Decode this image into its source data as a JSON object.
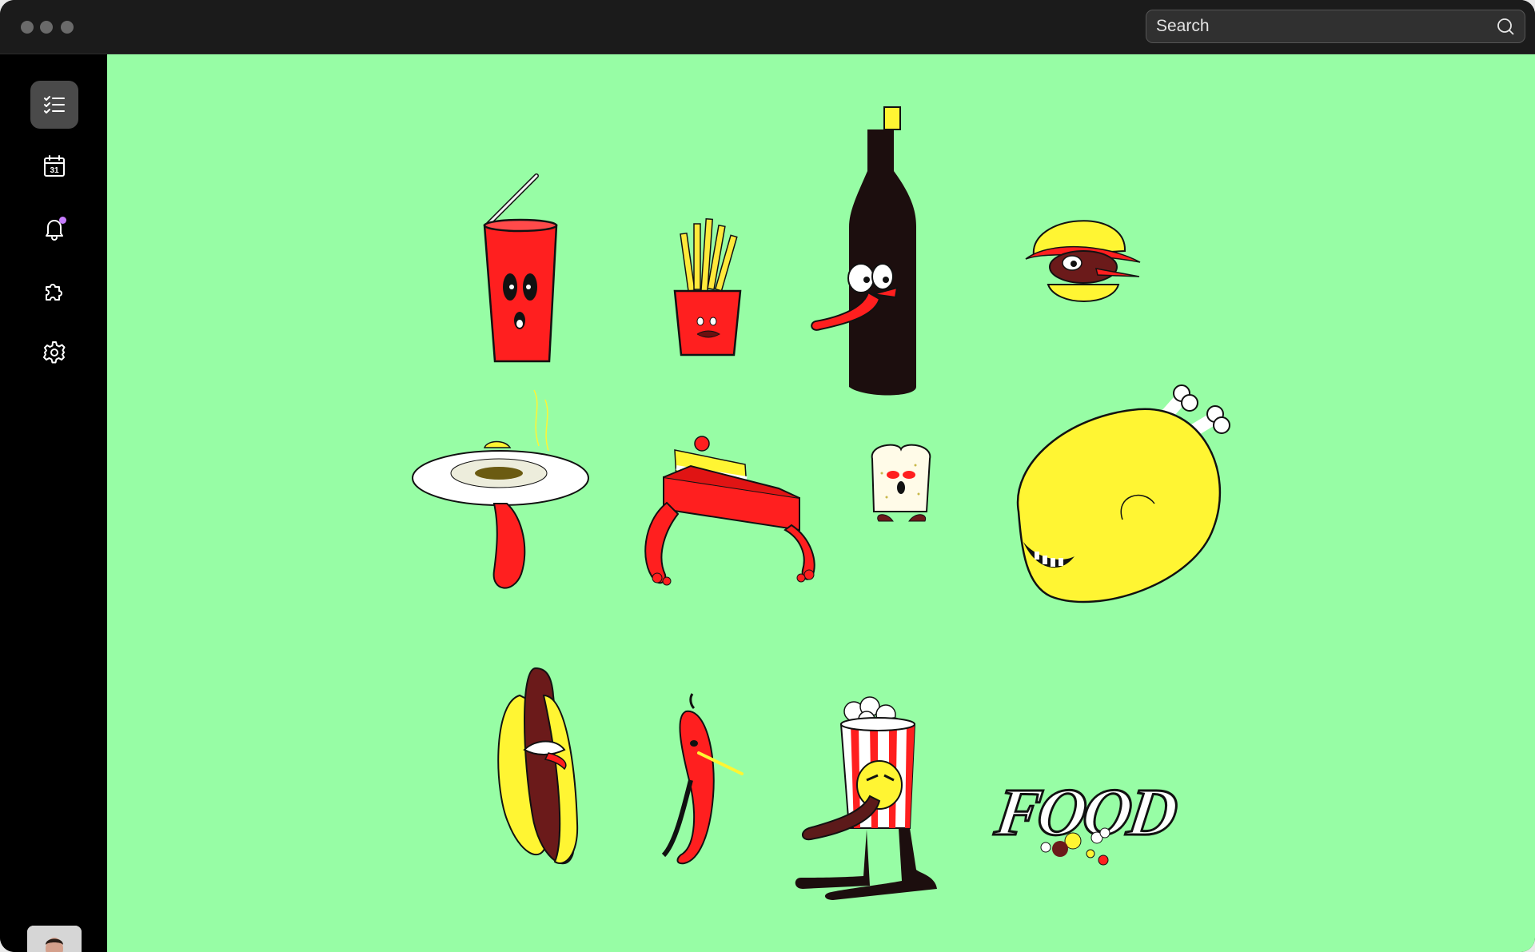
{
  "window": {
    "controls": [
      "window-dot",
      "window-dot",
      "window-dot"
    ]
  },
  "search": {
    "placeholder": "Search",
    "icon": "search-icon"
  },
  "sidebar": {
    "items": [
      {
        "name": "tasks",
        "icon": "checklist-icon",
        "active": true
      },
      {
        "name": "calendar",
        "icon": "calendar-icon",
        "label": "31"
      },
      {
        "name": "notifications",
        "icon": "bell-icon",
        "has_badge": true
      },
      {
        "name": "extensions",
        "icon": "puzzle-icon"
      },
      {
        "name": "settings",
        "icon": "gear-icon"
      }
    ],
    "avatar": "user-avatar"
  },
  "canvas": {
    "background": "#97fda5",
    "stickers": [
      {
        "name": "soda-cup-sticker"
      },
      {
        "name": "fries-sticker"
      },
      {
        "name": "bottle-sticker"
      },
      {
        "name": "burger-sticker"
      },
      {
        "name": "soup-plate-sticker"
      },
      {
        "name": "cake-box-sticker"
      },
      {
        "name": "toast-sticker"
      },
      {
        "name": "roast-chicken-sticker"
      },
      {
        "name": "hotdog-sticker"
      },
      {
        "name": "chili-pepper-sticker"
      },
      {
        "name": "popcorn-sticker"
      },
      {
        "name": "food-logo-sticker"
      }
    ],
    "logo_text": "FOOD"
  },
  "colors": {
    "red": "#ff1f1f",
    "yellow": "#fff533",
    "dark_brown": "#1c0e0e",
    "accent_purple": "#c77dff"
  }
}
